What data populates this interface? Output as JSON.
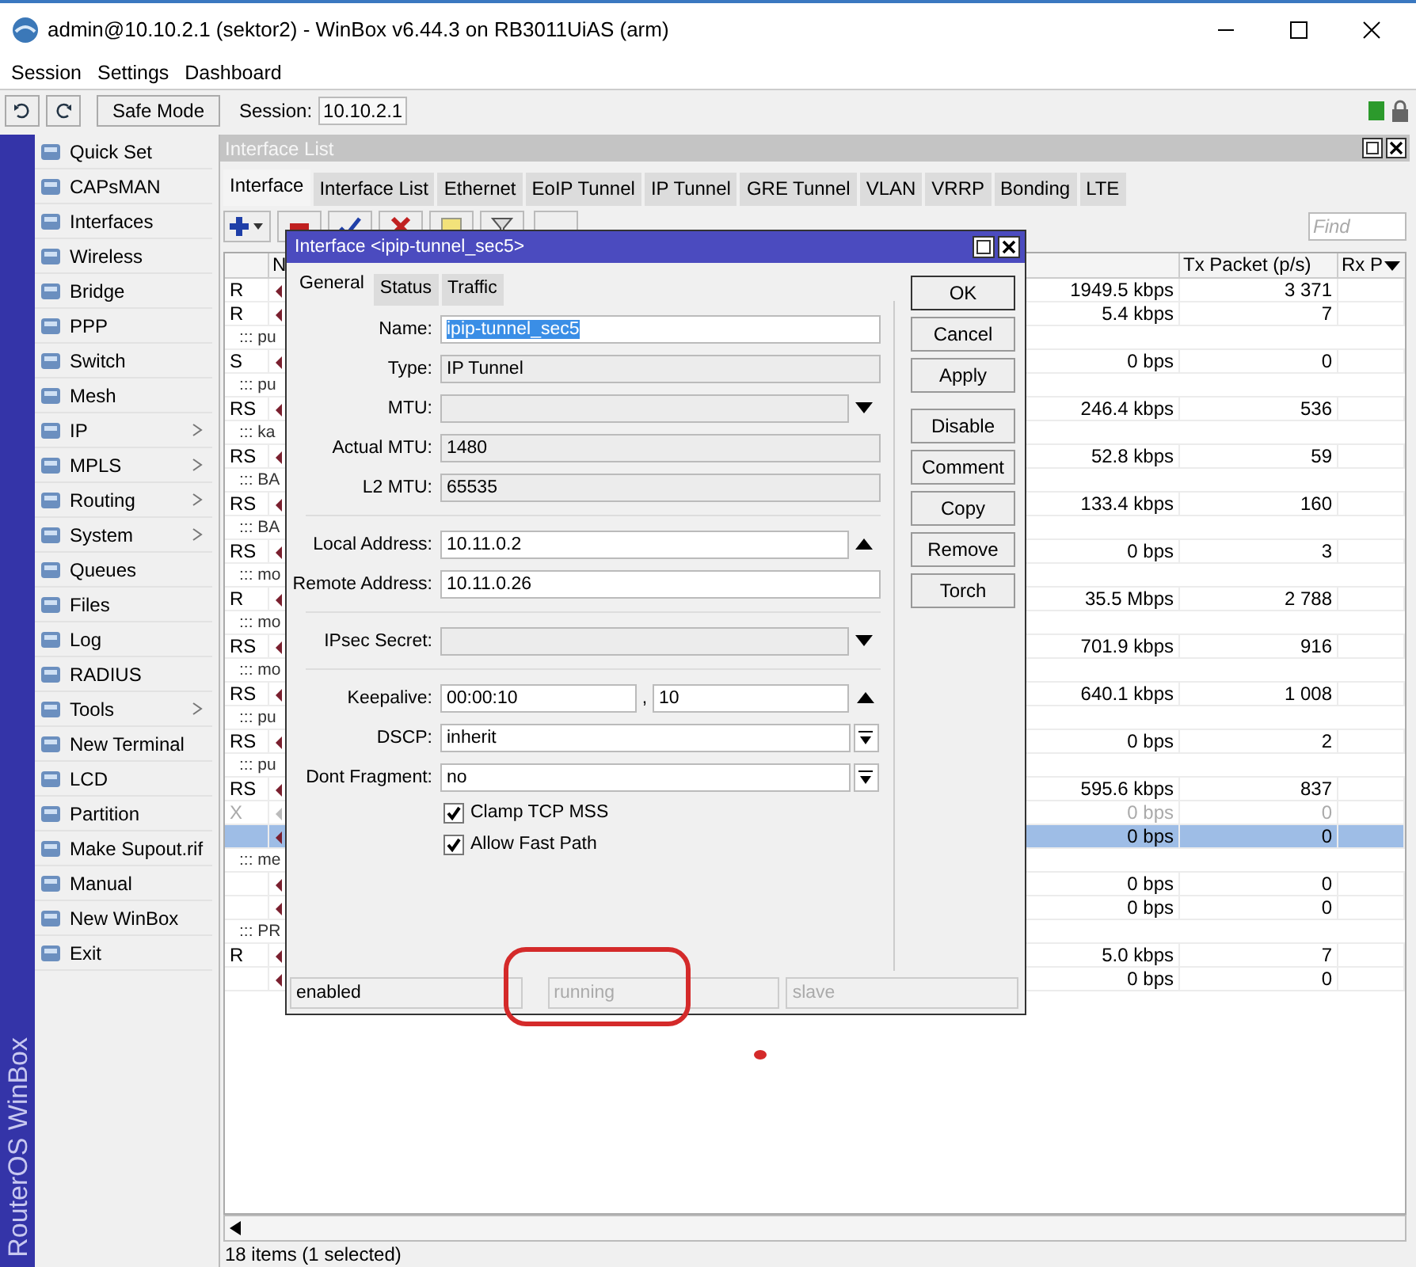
{
  "window": {
    "title": "admin@10.10.2.1 (sektor2) - WinBox v6.44.3 on RB3011UiAS (arm)"
  },
  "menu": [
    "Session",
    "Settings",
    "Dashboard"
  ],
  "toolbar": {
    "safe_mode": "Safe Mode",
    "session_label": "Session:",
    "session_value": "10.10.2.1"
  },
  "sidebar": {
    "brand": "RouterOS WinBox",
    "items": [
      {
        "label": "Quick Set",
        "submenu": false
      },
      {
        "label": "CAPsMAN",
        "submenu": false
      },
      {
        "label": "Interfaces",
        "submenu": false
      },
      {
        "label": "Wireless",
        "submenu": false
      },
      {
        "label": "Bridge",
        "submenu": false
      },
      {
        "label": "PPP",
        "submenu": false
      },
      {
        "label": "Switch",
        "submenu": false
      },
      {
        "label": "Mesh",
        "submenu": false
      },
      {
        "label": "IP",
        "submenu": true
      },
      {
        "label": "MPLS",
        "submenu": true
      },
      {
        "label": "Routing",
        "submenu": true
      },
      {
        "label": "System",
        "submenu": true
      },
      {
        "label": "Queues",
        "submenu": false
      },
      {
        "label": "Files",
        "submenu": false
      },
      {
        "label": "Log",
        "submenu": false
      },
      {
        "label": "RADIUS",
        "submenu": false
      },
      {
        "label": "Tools",
        "submenu": true
      },
      {
        "label": "New Terminal",
        "submenu": false
      },
      {
        "label": "LCD",
        "submenu": false
      },
      {
        "label": "Partition",
        "submenu": false
      },
      {
        "label": "Make Supout.rif",
        "submenu": false
      },
      {
        "label": "Manual",
        "submenu": false
      },
      {
        "label": "New WinBox",
        "submenu": false
      },
      {
        "label": "Exit",
        "submenu": false
      }
    ]
  },
  "interface_window": {
    "title": "Interface List",
    "tabs": [
      {
        "label": "Interface",
        "selected": true
      },
      {
        "label": "Interface List",
        "selected": false
      },
      {
        "label": "Ethernet",
        "selected": false
      },
      {
        "label": "EoIP Tunnel",
        "selected": false
      },
      {
        "label": "IP Tunnel",
        "selected": false
      },
      {
        "label": "GRE Tunnel",
        "selected": false
      },
      {
        "label": "VLAN",
        "selected": false
      },
      {
        "label": "VRRP",
        "selected": false
      },
      {
        "label": "Bonding",
        "selected": false
      },
      {
        "label": "LTE",
        "selected": false
      }
    ],
    "find": {
      "placeholder": "Find"
    },
    "table": {
      "columns": [
        "N",
        "Tx Packet (p/s)",
        "Rx P"
      ],
      "rows": [
        {
          "kind": "interface",
          "flags": "R",
          "tx_rate": "1949.5 kbps",
          "tx_packets": "3 371",
          "selected": false,
          "disabled": false
        },
        {
          "kind": "interface",
          "flags": "R",
          "tx_rate": "5.4 kbps",
          "tx_packets": "7",
          "selected": false,
          "disabled": false
        },
        {
          "kind": "comment",
          "text": "::: pu"
        },
        {
          "kind": "interface",
          "flags": "S",
          "tx_rate": "0 bps",
          "tx_packets": "0",
          "selected": false,
          "disabled": false
        },
        {
          "kind": "comment",
          "text": "::: pu"
        },
        {
          "kind": "interface",
          "flags": "RS",
          "tx_rate": "246.4 kbps",
          "tx_packets": "536",
          "selected": false,
          "disabled": false
        },
        {
          "kind": "comment",
          "text": "::: ka"
        },
        {
          "kind": "interface",
          "flags": "RS",
          "tx_rate": "52.8 kbps",
          "tx_packets": "59",
          "selected": false,
          "disabled": false
        },
        {
          "kind": "comment",
          "text": "::: BA"
        },
        {
          "kind": "interface",
          "flags": "RS",
          "tx_rate": "133.4 kbps",
          "tx_packets": "160",
          "selected": false,
          "disabled": false
        },
        {
          "kind": "comment",
          "text": "::: BA"
        },
        {
          "kind": "interface",
          "flags": "RS",
          "tx_rate": "0 bps",
          "tx_packets": "3",
          "selected": false,
          "disabled": false
        },
        {
          "kind": "comment",
          "text": "::: mo"
        },
        {
          "kind": "interface",
          "flags": "R",
          "tx_rate": "35.5 Mbps",
          "tx_packets": "2 788",
          "selected": false,
          "disabled": false
        },
        {
          "kind": "comment",
          "text": "::: mo"
        },
        {
          "kind": "interface",
          "flags": "RS",
          "tx_rate": "701.9 kbps",
          "tx_packets": "916",
          "selected": false,
          "disabled": false
        },
        {
          "kind": "comment",
          "text": "::: mo"
        },
        {
          "kind": "interface",
          "flags": "RS",
          "tx_rate": "640.1 kbps",
          "tx_packets": "1 008",
          "selected": false,
          "disabled": false
        },
        {
          "kind": "comment",
          "text": "::: pu"
        },
        {
          "kind": "interface",
          "flags": "RS",
          "tx_rate": "0 bps",
          "tx_packets": "2",
          "selected": false,
          "disabled": false
        },
        {
          "kind": "comment",
          "text": "::: pu"
        },
        {
          "kind": "interface",
          "flags": "RS",
          "tx_rate": "595.6 kbps",
          "tx_packets": "837",
          "selected": false,
          "disabled": false
        },
        {
          "kind": "interface",
          "flags": "X",
          "tx_rate": "0 bps",
          "tx_packets": "0",
          "selected": false,
          "disabled": true
        },
        {
          "kind": "interface",
          "tx_rate": "0 bps",
          "tx_packets": "0",
          "selected": true,
          "disabled": false
        },
        {
          "kind": "comment",
          "text": "::: me"
        },
        {
          "kind": "interface",
          "tx_rate": "0 bps",
          "tx_packets": "0",
          "selected": false,
          "disabled": false
        },
        {
          "kind": "interface",
          "tx_rate": "0 bps",
          "tx_packets": "0",
          "selected": false,
          "disabled": false
        },
        {
          "kind": "comment",
          "text": "::: PR"
        },
        {
          "kind": "interface",
          "flags": "R",
          "tx_rate": "5.0 kbps",
          "tx_packets": "7",
          "selected": false,
          "disabled": false
        },
        {
          "kind": "interface",
          "tx_rate": "0 bps",
          "tx_packets": "0",
          "selected": false,
          "disabled": false
        }
      ]
    },
    "status": "18 items (1 selected)"
  },
  "dialog": {
    "title": "Interface <ipip-tunnel_sec5>",
    "tabs": [
      {
        "label": "General",
        "selected": true
      },
      {
        "label": "Status",
        "selected": false
      },
      {
        "label": "Traffic",
        "selected": false
      }
    ],
    "field_groups": [
      [
        {
          "kind": "plain",
          "label": "Name:",
          "value": "ipip-tunnel_sec5",
          "editable": true,
          "highlighted": true
        },
        {
          "kind": "plain",
          "label": "Type:",
          "value": "IP Tunnel",
          "editable": false
        },
        {
          "kind": "dropdown",
          "label": "MTU:",
          "editable": false
        },
        {
          "kind": "plain",
          "label": "Actual MTU:",
          "value": "1480",
          "editable": false
        },
        {
          "kind": "plain",
          "label": "L2 MTU:",
          "value": "65535",
          "editable": false
        }
      ],
      [
        {
          "kind": "spinner",
          "label": "Local Address:",
          "value": "10.11.0.2",
          "editable": true
        },
        {
          "kind": "plain",
          "label": "Remote Address:",
          "value": "10.11.0.26",
          "editable": true
        }
      ],
      [
        {
          "kind": "dropdown",
          "label": "IPsec Secret:",
          "editable": false
        }
      ],
      [
        {
          "kind": "spinner",
          "label": "Keepalive:",
          "value": "00:00:10",
          "joiner": ",",
          "value_2": "10",
          "editable": true
        },
        {
          "kind": "combo",
          "label": "DSCP:",
          "value": "inherit",
          "editable": true
        },
        {
          "kind": "combo",
          "label": "Dont Fragment:",
          "value": "no",
          "editable": true
        }
      ]
    ],
    "checkboxes": [
      {
        "label": "Clamp TCP MSS",
        "checked": true
      },
      {
        "label": "Allow Fast Path",
        "checked": true
      }
    ],
    "button_groups": [
      [
        {
          "label": "OK",
          "default": true
        },
        {
          "label": "Cancel",
          "default": false
        },
        {
          "label": "Apply",
          "default": false
        }
      ],
      [
        {
          "label": "Disable",
          "default": false
        },
        {
          "label": "Comment",
          "default": false
        },
        {
          "label": "Copy",
          "default": false
        },
        {
          "label": "Remove",
          "default": false
        },
        {
          "label": "Torch",
          "default": false
        }
      ]
    ],
    "status_bar": [
      {
        "text": "enabled",
        "dimmed": false
      },
      {
        "text": "running",
        "dimmed": true
      },
      {
        "text": "slave",
        "dimmed": true
      }
    ]
  }
}
